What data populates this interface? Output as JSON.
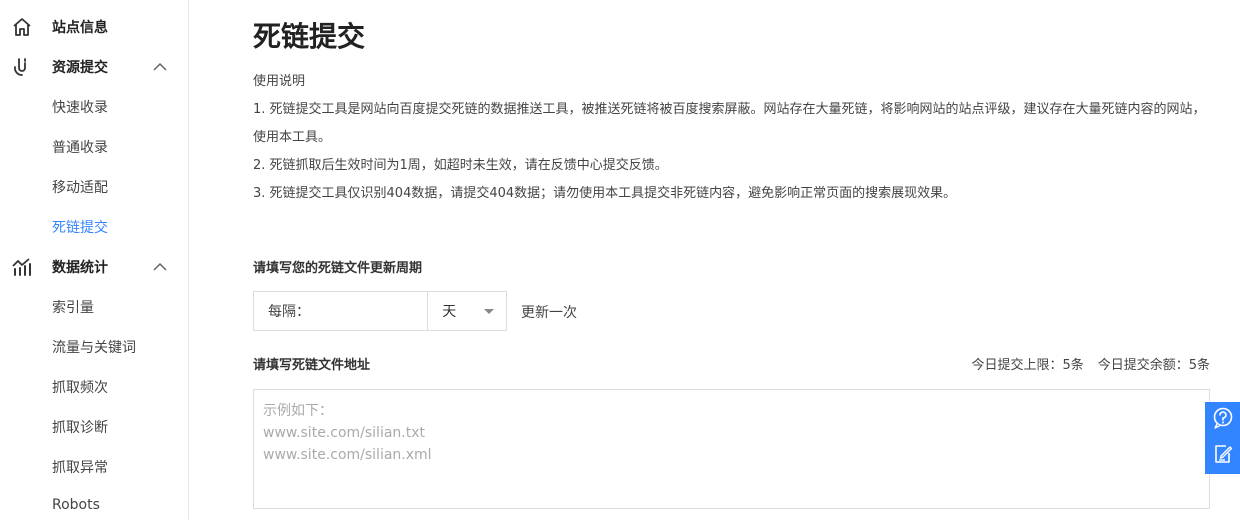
{
  "sidebar": {
    "site_info": "站点信息",
    "resource_submit": "资源提交",
    "resource_items": [
      "快速收录",
      "普通收录",
      "移动适配",
      "死链提交"
    ],
    "data_stats": "数据统计",
    "stats_items": [
      "索引量",
      "流量与关键词",
      "抓取频次",
      "抓取诊断",
      "抓取异常",
      "Robots"
    ]
  },
  "main": {
    "title": "死链提交",
    "usage_heading": "使用说明",
    "usage_lines": [
      "1. 死链提交工具是网站向百度提交死链的数据推送工具，被推送死链将被百度搜索屏蔽。网站存在大量死链，将影响网站的站点评级，建议存在大量死链内容的网站，使用本工具。",
      "2. 死链抓取后生效时间为1周，如超时未生效，请在反馈中心提交反馈。",
      "3. 死链提交工具仅识别404数据，请提交404数据；请勿使用本工具提交非死链内容，避免影响正常页面的搜索展现效果。"
    ],
    "period_label": "请填写您的死链文件更新周期",
    "period_prefix": "每隔：",
    "period_unit": "天",
    "period_suffix": "更新一次",
    "url_label": "请填写死链文件地址",
    "quota_limit": "今日提交上限：5条",
    "quota_remaining": "今日提交余额：5条",
    "url_placeholder_lines": [
      "示例如下：",
      "www.site.com/silian.txt",
      "www.site.com/silian.xml"
    ]
  },
  "colors": {
    "accent": "#3385ff"
  }
}
